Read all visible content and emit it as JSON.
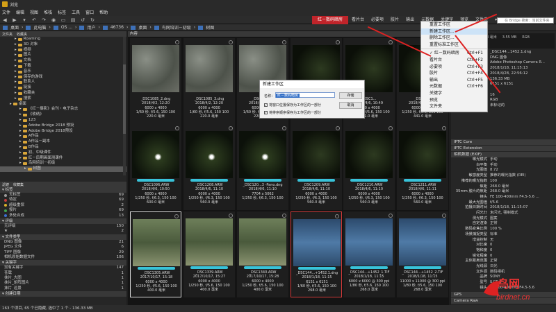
{
  "app": {
    "title": "浏览"
  },
  "menu": [
    "文件",
    "编辑",
    "视图",
    "堆栈",
    "标签",
    "工具",
    "窗口",
    "帮助"
  ],
  "workspaces": [
    "红－数码暗房",
    "看片台",
    "必要项",
    "胶片",
    "输出",
    "元数据",
    "关键字",
    "预览",
    "文件夹"
  ],
  "search": {
    "placeholder": "在 Bridge 搜索：当前文件夹"
  },
  "path": [
    "桌面",
    "此电脑",
    "OS ...",
    "用户",
    "46736",
    "桌面",
    "鸟网培训－初级",
    "树图"
  ],
  "left": {
    "tabs": [
      "文件夹",
      "收藏夹"
    ],
    "folders": [
      {
        "label": "Roaming",
        "indent": 3
      },
      {
        "label": "3D 对象",
        "indent": 3
      },
      {
        "label": "视频",
        "indent": 3
      },
      {
        "label": "图片",
        "indent": 3
      },
      {
        "label": "文档",
        "indent": 3
      },
      {
        "label": "下载",
        "indent": 3
      },
      {
        "label": "音乐",
        "indent": 3
      },
      {
        "label": "保存的游戏",
        "indent": 3
      },
      {
        "label": "联系人",
        "indent": 3
      },
      {
        "label": "链接",
        "indent": 3
      },
      {
        "label": "收藏夹",
        "indent": 3
      },
      {
        "label": "搜索",
        "indent": 3
      },
      {
        "label": "桌面",
        "indent": 2
      },
      {
        "label": "《红－摄影》会刊・电子杂志",
        "indent": 4
      },
      {
        "label": "《收纳》",
        "indent": 4
      },
      {
        "label": "123",
        "indent": 4
      },
      {
        "label": "Adobe Bridge 2018 预设",
        "indent": 4
      },
      {
        "label": "Adobe Bridge 2018预设",
        "indent": 4
      },
      {
        "label": "A作品",
        "indent": 4
      },
      {
        "label": "A作品－副本",
        "indent": 4
      },
      {
        "label": "B作品",
        "indent": 4
      },
      {
        "label": "初、中级课件",
        "indent": 4
      },
      {
        "label": "红－后期画面测课件",
        "indent": 4
      },
      {
        "label": "鸟网培训－初级",
        "indent": 4
      },
      {
        "label": "树图",
        "indent": 5,
        "selected": true
      }
    ]
  },
  "filter": {
    "tabs": [
      "滤镜",
      "收藏集"
    ],
    "label_section": "标签",
    "labels": [
      {
        "name": "无标签",
        "count": "69",
        "color": "#9a9a9a"
      },
      {
        "name": "待定",
        "count": "69",
        "color": "#c23b3b"
      },
      {
        "name": "超级重保",
        "count": "2",
        "color": "#d8b02a"
      },
      {
        "name": "慢片",
        "count": "69",
        "color": "#3fa34d"
      },
      {
        "name": "多处合成",
        "count": "13",
        "color": "#3c6fd0"
      }
    ],
    "rating_section": "评级",
    "ratings": [
      {
        "name": "无评级",
        "count": "150"
      },
      {
        "name": "★",
        "count": "2"
      }
    ],
    "type_section": "文件类型",
    "types": [
      {
        "name": "DNG 图像",
        "count": "21"
      },
      {
        "name": "JPEG 文件",
        "count": "6"
      },
      {
        "name": "TIFF 图像",
        "count": "29"
      },
      {
        "name": "相机原始数据文件",
        "count": "106"
      }
    ],
    "kw_section": "关键字",
    "keywords": [
      {
        "name": "没有关键字",
        "count": "147"
      },
      {
        "name": "苍鹭",
        "count": "1"
      },
      {
        "name": "抹片_大图",
        "count": "1"
      },
      {
        "name": "抹片_矩阵图片",
        "count": "1"
      },
      {
        "name": "抹片_远景",
        "count": "1"
      }
    ],
    "date_section": "创建日期"
  },
  "content": {
    "tab": "内容",
    "thumbs": [
      {
        "name": "_DSC1085_2.dng",
        "l2": "2018/4/2, 12:20",
        "l3": "6000 x 4000",
        "l4": "1/60 秒, f/5.6, 150 100",
        "l5": "220.0 毫米",
        "tone": "stone"
      },
      {
        "name": "_DSC1085_3.dng",
        "l2": "2018/4/2, 12:20",
        "l3": "6000 x 4000",
        "l4": "1/60 秒, f/5.6, 150 100",
        "l5": "220.0 毫米",
        "tone": "stone"
      },
      {
        "name": "_DSC1085...",
        "l2": "2018/4/2, 12:20",
        "l3": "6000 x 4000",
        "l4": "1/60 秒, f/5.6, 150 100",
        "l5": "220.0 毫米",
        "tone": "stone"
      },
      {
        "name": "",
        "l2": "",
        "l3": "",
        "l4": "",
        "l5": "",
        "tone": "dark"
      },
      {
        "name": "_DSC1...",
        "l2": "2018/4/6, 10:49",
        "l3": "6000 x 4000",
        "l4": "1/250 秒, f/5.6, 150 100",
        "l5": "441.0 毫米",
        "tone": "dark"
      },
      {
        "name": "_DSC11...",
        "l2": "2018/4/6, 10:49",
        "l3": "6000 x 4000",
        "l4": "1/250 秒, f/5.6, 150 100",
        "l5": "441.0 毫米",
        "tone": "dark"
      },
      {
        "name": "_DSC1096.ARW",
        "l2": "2018/4/6, 10:50",
        "l3": "6000 x 4000",
        "l4": "1/250 秒, f/6.3, 150 100",
        "l5": "600.0 毫米",
        "tone": "egret",
        "label": true
      },
      {
        "name": "_DSC1208.ARW",
        "l2": "2018/4/6, 11:10",
        "l3": "6000 x 4000",
        "l4": "1/250 秒, f/6.3, 150 100",
        "l5": "560.0 毫米",
        "tone": "egret",
        "label": true
      },
      {
        "name": "_DSC120...3 -Pano.dng",
        "l2": "2018/4/6, 11:10",
        "l3": "7704 x 5062",
        "l4": "1/250 秒, f/6.3, 150 100",
        "l5": "",
        "tone": "egret",
        "label": true
      },
      {
        "name": "_DSC1209.ARW",
        "l2": "2018/4/6, 11:10",
        "l3": "6000 x 4000",
        "l4": "1/250 秒, f/6.3, 150 100",
        "l5": "560.0 毫米",
        "tone": "dark",
        "label": true
      },
      {
        "name": "_DSC1210.ARW",
        "l2": "2018/4/6, 11:10",
        "l3": "6000 x 4000",
        "l4": "1/250 秒, f/6.3, 150 100",
        "l5": "560.0 毫米",
        "tone": "dark",
        "label": true
      },
      {
        "name": "_DSC1211.ARW",
        "l2": "2018/4/6, 11:11",
        "l3": "6000 x 4000",
        "l4": "1/250 秒, f/6.3, 150 100",
        "l5": "560.0 毫米",
        "tone": "dark",
        "label": true
      },
      {
        "name": "_DSC1305.ARW",
        "l2": "2017/10/17, 15:18",
        "l3": "6000 x 4000",
        "l4": "1/250 秒, f/5.6, 150 100",
        "l5": "400.0 毫米",
        "tone": "pond",
        "label": true,
        "white": true
      },
      {
        "name": "_DSC1339.ARW",
        "l2": "2017/10/17, 15:27",
        "l3": "6000 x 4000",
        "l4": "1/250 秒, f/5.6, 150 100",
        "l5": "400.0 毫米",
        "tone": "pond",
        "label": true
      },
      {
        "name": "_DSC1340.ARW",
        "l2": "2017/10/17, 15:28",
        "l3": "6000 x 4000",
        "l4": "1/250 秒, f/5.6, 150 100",
        "l5": "400.0 毫米",
        "tone": "pond",
        "label": true
      },
      {
        "name": "_DSC144...+1452.1.dng",
        "l2": "2018/1/18, 11:15",
        "l3": "6151 x 6151",
        "l4": "1/60 秒, f/5.6, 150 100",
        "l5": "268.0 毫米",
        "tone": "blue",
        "label": true,
        "selected": true
      },
      {
        "name": "_DSC144...+1452_1.TIF",
        "l2": "2018/1/18, 11:15",
        "l3": "6000 x 6000 @ 300 ppi",
        "l4": "1/80 秒, f/5.6, 150 100",
        "l5": "268.0 毫米",
        "tone": "blue",
        "label": true
      },
      {
        "name": "_DSC144...+1452_2.TIF",
        "l2": "2018/1/18, 11:15",
        "l3": "11000 x 11000 @ 300 ppi",
        "l4": "1/80 秒, f/5.6, 150 100",
        "l5": "268.0 毫米",
        "tone": "blue",
        "label": true
      }
    ]
  },
  "dialog": {
    "title": "新建工作区",
    "name_label": "名称：",
    "name_value": "红－数码暗房",
    "cb1": "将窗口位置保存为工作区的一部分",
    "cb2": "将排序顺序保存为工作区的一部分",
    "ok": "存储",
    "cancel": "取消"
  },
  "dropdown": [
    {
      "label": "重置工作区",
      "key": ""
    },
    {
      "label": "新建工作区...",
      "key": "",
      "hl": true
    },
    {
      "label": "删除工作区...",
      "key": ""
    },
    {
      "label": "重置标准工作区",
      "key": ""
    },
    {
      "label": "sep"
    },
    {
      "label": "红－数码暗房",
      "key": "Ctrl+F1",
      "checked": true
    },
    {
      "label": "看片台",
      "key": "Ctrl+F2"
    },
    {
      "label": "必要项",
      "key": "Ctrl+F3"
    },
    {
      "label": "胶片",
      "key": "Ctrl+F4"
    },
    {
      "label": "输出",
      "key": "Ctrl+F5"
    },
    {
      "label": "元数据",
      "key": "Ctrl+F6"
    },
    {
      "label": "关键字",
      "key": ""
    },
    {
      "label": "预览",
      "key": ""
    },
    {
      "label": "文件夹",
      "key": ""
    }
  ],
  "right": {
    "preview": [
      "6151 x 6151",
      "268 毫米",
      "3.55 MB",
      "RGB"
    ],
    "meta": [
      [
        "文件名",
        "_DSC144...1452.1.dng"
      ],
      [
        "文档类型",
        "DNG 图像"
      ],
      [
        "应用程序",
        "Adobe Photoshop Camera R..."
      ],
      [
        "创建日期",
        "2018/1/18, 11:15:13"
      ],
      [
        "修改日期",
        "2018/4/28, 22:56:12"
      ],
      [
        "文件大小",
        "136.33 MB"
      ],
      [
        "尺寸",
        "6151 x 6151"
      ],
      [
        "尺寸(英寸)",
        ""
      ],
      [
        "位深度",
        "16"
      ],
      [
        "颜色模式",
        "RGB"
      ],
      [
        "颜色配置文件",
        "未标记的"
      ]
    ],
    "sec_iptc": "IPTC Core",
    "sec_iptc_ext": "IPTC Extension",
    "sec_exif": "相机数据 (EXIF)",
    "exif": [
      [
        "曝光模式",
        "手动"
      ],
      [
        "白平衡",
        "手动"
      ],
      [
        "光圈值",
        "8.72"
      ],
      [
        "敏感度类型",
        "推荐的曝光指数 (REI)"
      ],
      [
        "推荐的曝光指数",
        "100"
      ],
      [
        "焦距",
        "268.0 毫米"
      ],
      [
        "35mm 胶片的焦距",
        "268.0 毫米"
      ],
      [
        "镜头",
        "FE 100-400mm F4.5-5.6 ..."
      ],
      [
        "最大光圈值",
        "f/5.6"
      ],
      [
        "拍摄日期时间",
        "2018/1/18, 11:15:07"
      ],
      [
        "闪光灯",
        "未闪光, 强制模式"
      ],
      [
        "测光模式",
        "图案"
      ],
      [
        "自定渲染",
        "正常"
      ],
      [
        "数码变焦比例",
        "100 %"
      ],
      [
        "场景捕捉类型",
        "标准"
      ],
      [
        "增益控制",
        "无"
      ],
      [
        "对比度",
        "0"
      ],
      [
        "饱和度",
        "0"
      ],
      [
        "锐化程度",
        "0"
      ],
      [
        "主体距离范围",
        "正常"
      ],
      [
        "光线源",
        "日光"
      ],
      [
        "文件源",
        "数码相机"
      ],
      [
        "品牌",
        "SONY"
      ],
      [
        "型号",
        "ILCE-9"
      ],
      [
        "镜头",
        "FE 100-400mm F4.5-5.6"
      ]
    ],
    "sec_gps": "GPS",
    "sec_raw": "Camera Raw"
  },
  "status": "163 个项目, 65 个已隐藏, 选中了 1 个 - 136.33 MB",
  "watermark": {
    "text": "鸟网",
    "url": "birdnet.cn"
  }
}
